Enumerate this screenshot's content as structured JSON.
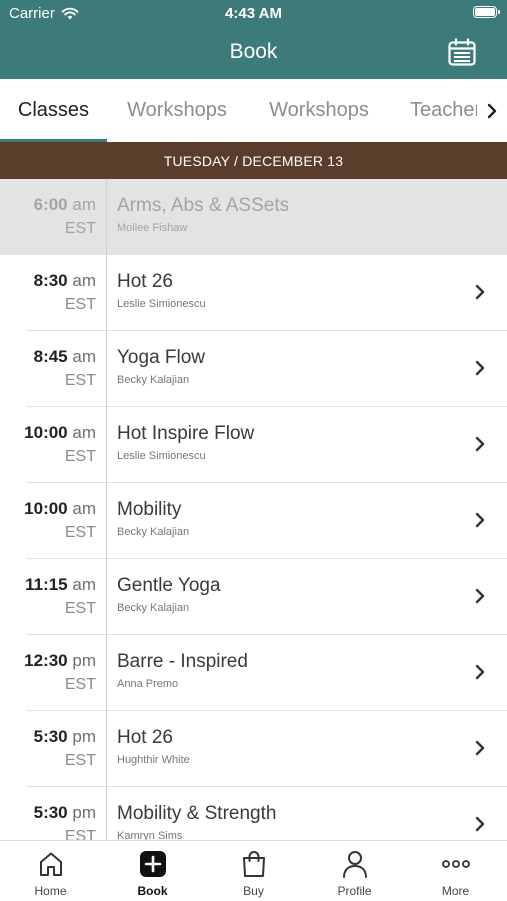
{
  "status": {
    "carrier": "Carrier",
    "time": "4:43 AM"
  },
  "header": {
    "title": "Book",
    "calendar_icon": "calendar-icon"
  },
  "tabs": [
    {
      "label": "Classes",
      "active": true
    },
    {
      "label": "Workshops",
      "active": false
    },
    {
      "label": "Workshops",
      "active": false
    },
    {
      "label": "Teachers",
      "active": false
    }
  ],
  "date_bar": "TUESDAY / DECEMBER 13",
  "classes": [
    {
      "time": "6:00",
      "ampm": "am",
      "tz": "EST",
      "name": "Arms, Abs & ASSets",
      "instructor": "Mollee Fishaw",
      "disabled": true
    },
    {
      "time": "8:30",
      "ampm": "am",
      "tz": "EST",
      "name": "Hot 26",
      "instructor": "Leslie Simionescu",
      "disabled": false
    },
    {
      "time": "8:45",
      "ampm": "am",
      "tz": "EST",
      "name": "Yoga Flow",
      "instructor": "Becky Kalajian",
      "disabled": false
    },
    {
      "time": "10:00",
      "ampm": "am",
      "tz": "EST",
      "name": "Hot Inspire Flow",
      "instructor": "Leslie Simionescu",
      "disabled": false
    },
    {
      "time": "10:00",
      "ampm": "am",
      "tz": "EST",
      "name": "Mobility",
      "instructor": "Becky Kalajian",
      "disabled": false
    },
    {
      "time": "11:15",
      "ampm": "am",
      "tz": "EST",
      "name": "Gentle Yoga",
      "instructor": "Becky Kalajian",
      "disabled": false
    },
    {
      "time": "12:30",
      "ampm": "pm",
      "tz": "EST",
      "name": "Barre - Inspired",
      "instructor": "Anna Premo",
      "disabled": false
    },
    {
      "time": "5:30",
      "ampm": "pm",
      "tz": "EST",
      "name": "Hot 26",
      "instructor": "Hughthir White",
      "disabled": false
    },
    {
      "time": "5:30",
      "ampm": "pm",
      "tz": "EST",
      "name": "Mobility & Strength",
      "instructor": "Kamryn Sims",
      "disabled": false
    }
  ],
  "bottom_nav": [
    {
      "label": "Home",
      "icon": "home-icon",
      "active": false
    },
    {
      "label": "Book",
      "icon": "book-plus-icon",
      "active": true
    },
    {
      "label": "Buy",
      "icon": "shopping-bag-icon",
      "active": false
    },
    {
      "label": "Profile",
      "icon": "profile-icon",
      "active": false
    },
    {
      "label": "More",
      "icon": "more-dots-icon",
      "active": false
    }
  ],
  "colors": {
    "header": "#3d7a7a",
    "date_bar": "#5a3d2b",
    "disabled_row": "#e3e3e3"
  }
}
